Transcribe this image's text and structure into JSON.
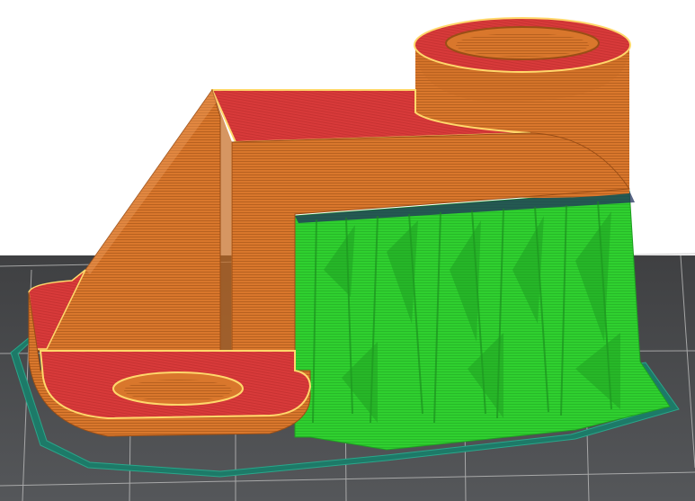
{
  "viewport": {
    "label": "",
    "colors": {
      "background": "#ffffff",
      "bed": "#4b4c4e",
      "bed_grid": "#bdbdbd",
      "skirt": "#1d7a68",
      "perimeter": "#d9772c",
      "perimeter_line": "#9a4e16",
      "top_solid": "#d83a3a",
      "top_solid_line": "#b52a2a",
      "support": "#2fd02f",
      "support_dark": "#1f9d22",
      "support_interface": "#22315e",
      "edge_highlight": "#ffd86b"
    }
  },
  "layers": {
    "types": [
      "perimeter",
      "top-solid-infill",
      "support-material",
      "support-interface",
      "skirt"
    ]
  }
}
